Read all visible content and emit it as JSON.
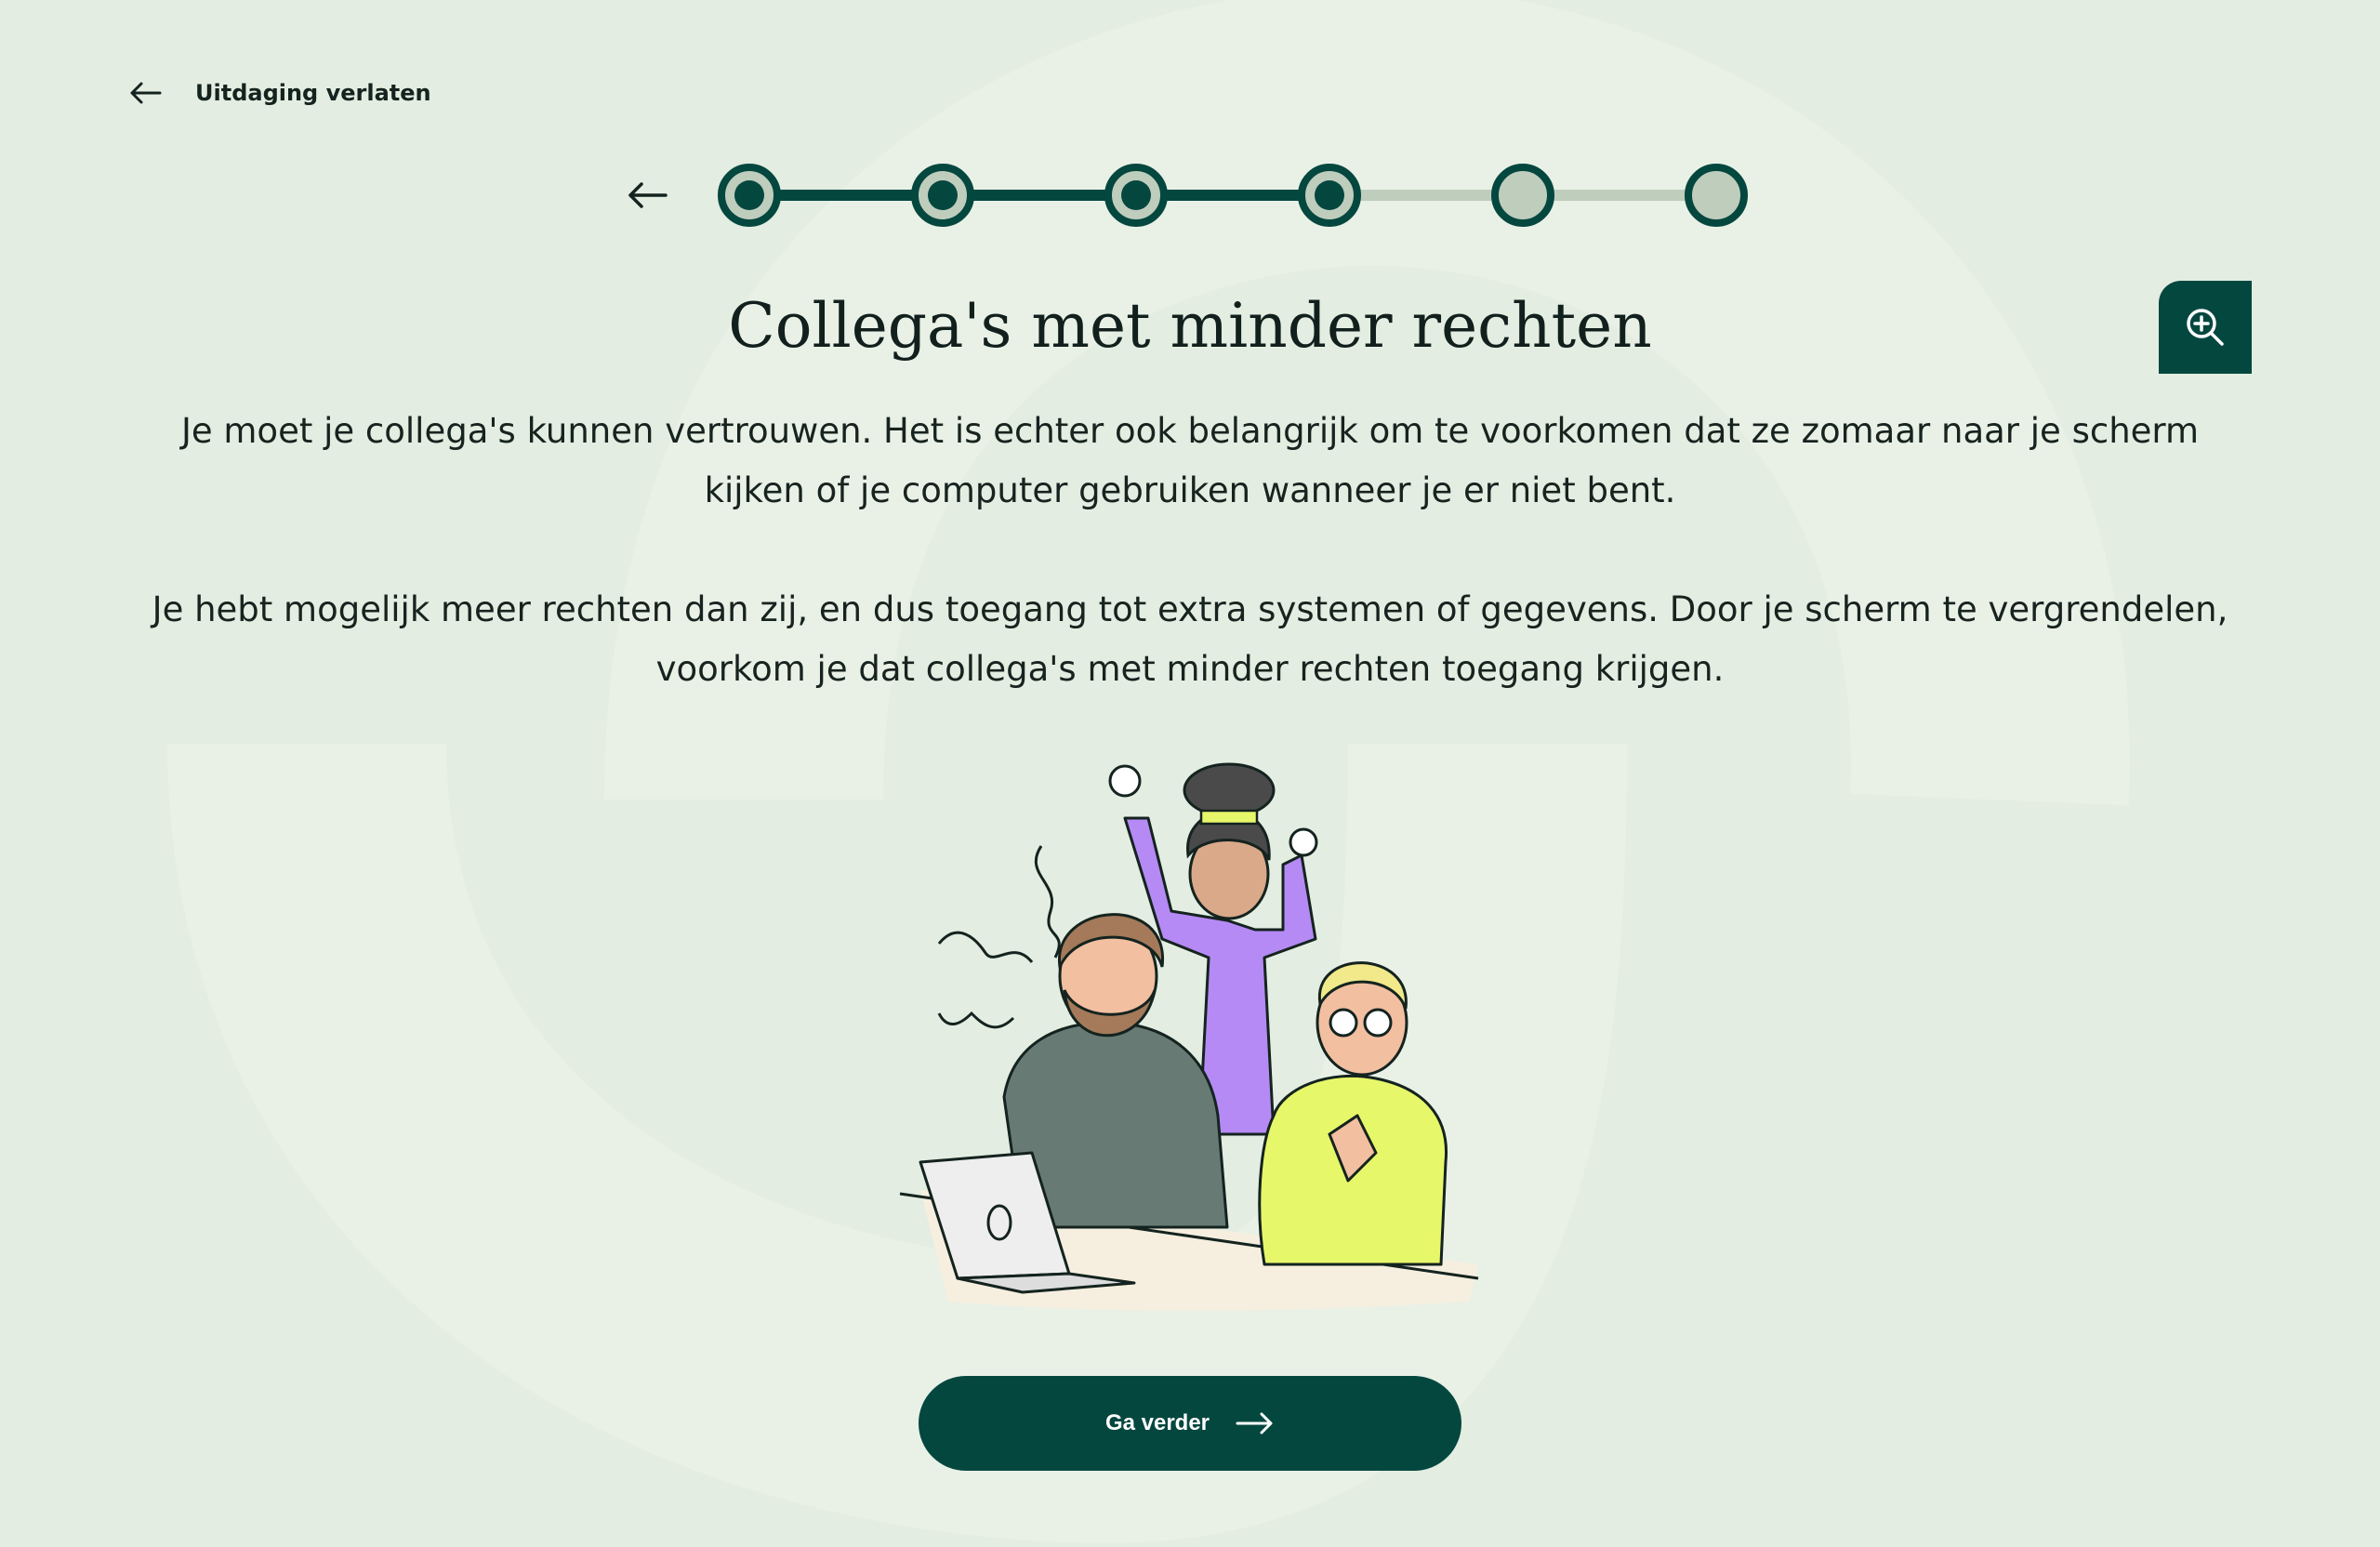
{
  "header": {
    "exit_label": "Uitdaging verlaten",
    "exit_icon": "arrow-left-icon"
  },
  "progress": {
    "total_steps": 6,
    "completed_steps": 4,
    "back_icon": "arrow-left-icon"
  },
  "zoom": {
    "icon": "zoom-in-icon"
  },
  "content": {
    "title": "Collega's met minder rechten",
    "paragraph_1": "Je moet je collega's kunnen vertrouwen. Het is echter ook belangrijk om te voorkomen dat ze zomaar naar je scherm kijken of je computer gebruiken wanneer je er niet bent.",
    "paragraph_2": "Je hebt mogelijk meer rechten dan zij, en dus toegang tot extra systemen of gegevens. Door je scherm te vergrendelen, voorkom je dat collega's met minder rechten toegang krijgen."
  },
  "cta": {
    "label": "Ga verder",
    "icon": "arrow-right-icon"
  },
  "colors": {
    "background": "#e3ede1",
    "accent": "#04473f",
    "inactive_step": "#bfcdbd"
  }
}
